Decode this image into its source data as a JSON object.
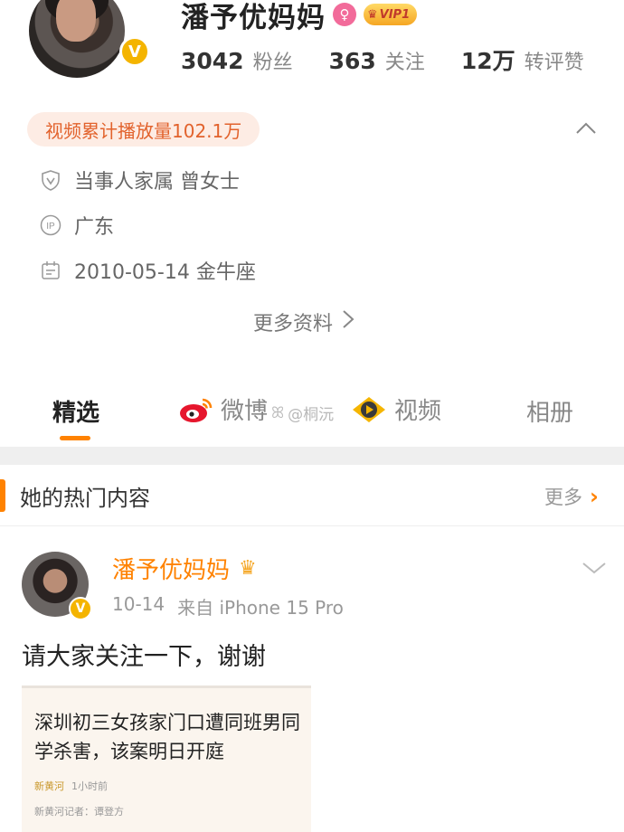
{
  "profile": {
    "name": "潘予优妈妈",
    "vip_label": "VIP1",
    "stats": [
      {
        "num": "3042",
        "label": "粉丝"
      },
      {
        "num": "363",
        "label": "关注"
      },
      {
        "num": "12万",
        "label": "转评赞"
      }
    ],
    "play_count": "视频累计播放量102.1万",
    "info": {
      "verification": "当事人家属 曾女士",
      "ip_location": "广东",
      "birthday": "2010-05-14 金牛座"
    },
    "more_info": "更多资料"
  },
  "tabs": [
    {
      "label": "精选"
    },
    {
      "label": "微博"
    },
    {
      "label": "视频"
    },
    {
      "label": "相册"
    }
  ],
  "watermark": "@桐沅",
  "hot_section": {
    "title": "她的热门内容",
    "more_label": "更多"
  },
  "post": {
    "author": "潘予优妈妈",
    "date": "10-14",
    "source": "来自 iPhone 15 Pro",
    "text": "请大家关注一下，谢谢",
    "card": {
      "title": "深圳初三女孩家门口遭同班男同学杀害，该案明日开庭",
      "source_brand": "新黄河",
      "source_time": "1小时前",
      "reporter": "新黄河记者：谭登方"
    }
  },
  "colors": {
    "accent": "#ff8200",
    "play_pill_bg": "#fdece4",
    "play_pill_text": "#e2622c",
    "verified_badge": "#f4b400"
  }
}
